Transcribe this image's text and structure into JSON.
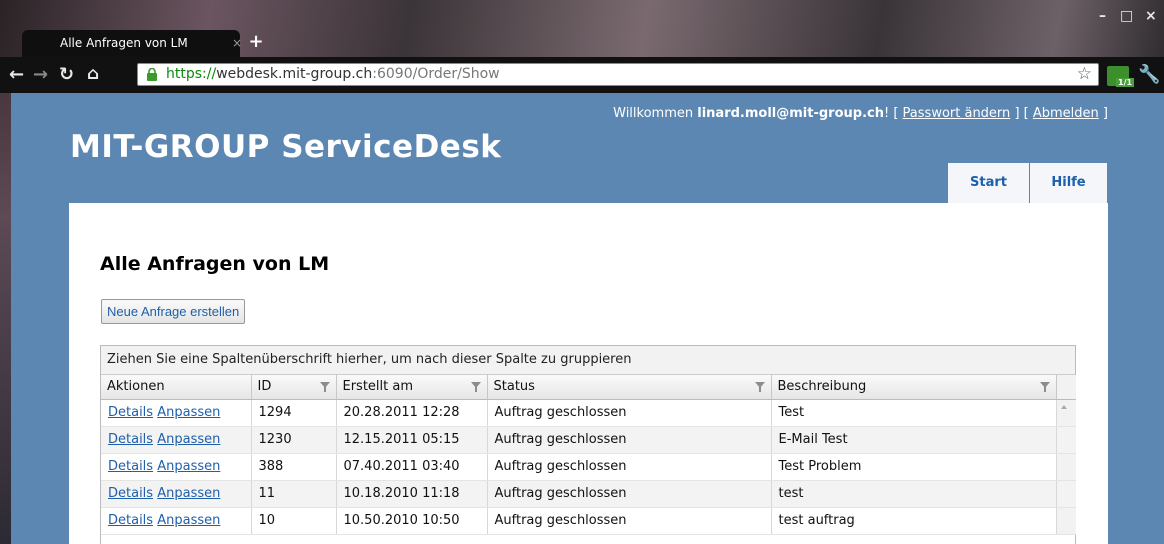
{
  "browser": {
    "tab_title": "Alle Anfragen von LM",
    "tab_close": "×",
    "new_tab": "+",
    "url_scheme": "https://",
    "url_host": "webdesk.mit-group.ch",
    "url_rest": ":6090/Order/Show",
    "ext_badge": "1/1"
  },
  "header": {
    "welcome_prefix": "Willkommen",
    "user": "linard.moll@mit-group.ch",
    "welcome_suffix": "! [",
    "change_password": "Passwort ändern",
    "sep": "] [",
    "logout": "Abmelden",
    "end": "]",
    "site_title": "MIT-GROUP ServiceDesk"
  },
  "nav": {
    "start": "Start",
    "help": "Hilfe"
  },
  "main": {
    "heading": "Alle Anfragen von LM",
    "new_request": "Neue Anfrage erstellen",
    "group_hint": "Ziehen Sie eine Spaltenüberschrift hierher, um nach dieser Spalte zu gruppieren",
    "columns": [
      "Aktionen",
      "ID",
      "Erstellt am",
      "Status",
      "Beschreibung"
    ],
    "rows": [
      {
        "details": "Details",
        "edit": "Anpassen",
        "id": "1294",
        "created": "20.28.2011 12:28",
        "status": "Auftrag geschlossen",
        "desc": "Test"
      },
      {
        "details": "Details",
        "edit": "Anpassen",
        "id": "1230",
        "created": "12.15.2011 05:15",
        "status": "Auftrag geschlossen",
        "desc": "E-Mail Test"
      },
      {
        "details": "Details",
        "edit": "Anpassen",
        "id": "388",
        "created": "07.40.2011 03:40",
        "status": "Auftrag geschlossen",
        "desc": "Test Problem"
      },
      {
        "details": "Details",
        "edit": "Anpassen",
        "id": "11",
        "created": "10.18.2010 11:18",
        "status": "Auftrag geschlossen",
        "desc": "test"
      },
      {
        "details": "Details",
        "edit": "Anpassen",
        "id": "10",
        "created": "10.50.2010 10:50",
        "status": "Auftrag geschlossen",
        "desc": "test auftrag"
      }
    ]
  }
}
